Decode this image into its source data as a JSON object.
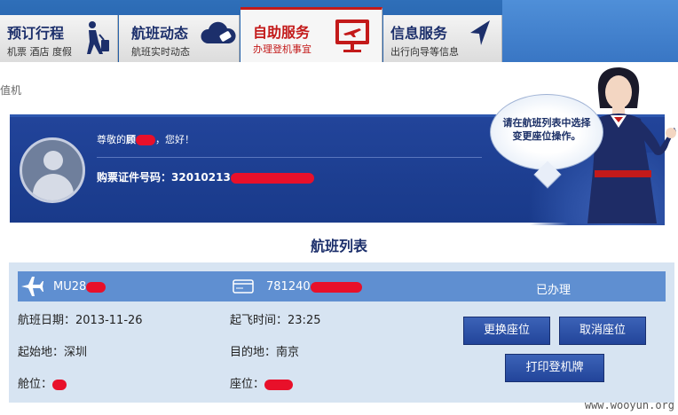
{
  "nav": {
    "tabs": [
      {
        "title": "预订行程",
        "sub": "机票 酒店 度假",
        "icon": "traveler-icon"
      },
      {
        "title": "航班动态",
        "sub": "航班实时动态",
        "icon": "cloud-tag-icon"
      },
      {
        "title": "自助服务",
        "sub": "办理登机事宜",
        "icon": "monitor-plane-icon",
        "active": true
      },
      {
        "title": "信息服务",
        "sub": "出行向导等信息",
        "icon": "arrow-pointer-icon"
      }
    ]
  },
  "breadcrumb": "值机",
  "passenger": {
    "greeting_prefix": "尊敬的",
    "name": "顾",
    "greeting_suffix": "，您好！",
    "id_label": "购票证件号码：",
    "id_value": "32010213"
  },
  "bubble_text": "请在航班列表中选择变更座位操作。",
  "list_title": "航班列表",
  "flight": {
    "flight_no": "MU28",
    "ticket_no": "781240",
    "status": "已办理",
    "date_label": "航班日期：",
    "date": "2013-11-26",
    "takeoff_label": "起飞时间：",
    "takeoff": "23:25",
    "origin_label": "起始地：",
    "origin": "深圳",
    "dest_label": "目的地：",
    "dest": "南京",
    "cabin_label": "舱位：",
    "seat_label": "座位："
  },
  "buttons": {
    "change_seat": "更换座位",
    "cancel_seat": "取消座位",
    "print_pass": "打印登机牌"
  },
  "watermark": "www.wooyun.org",
  "colors": {
    "brand_blue": "#1c2f6b",
    "active_red": "#c31a1a",
    "bar_blue": "#5f8fd1",
    "redaction": "#e8102a"
  }
}
